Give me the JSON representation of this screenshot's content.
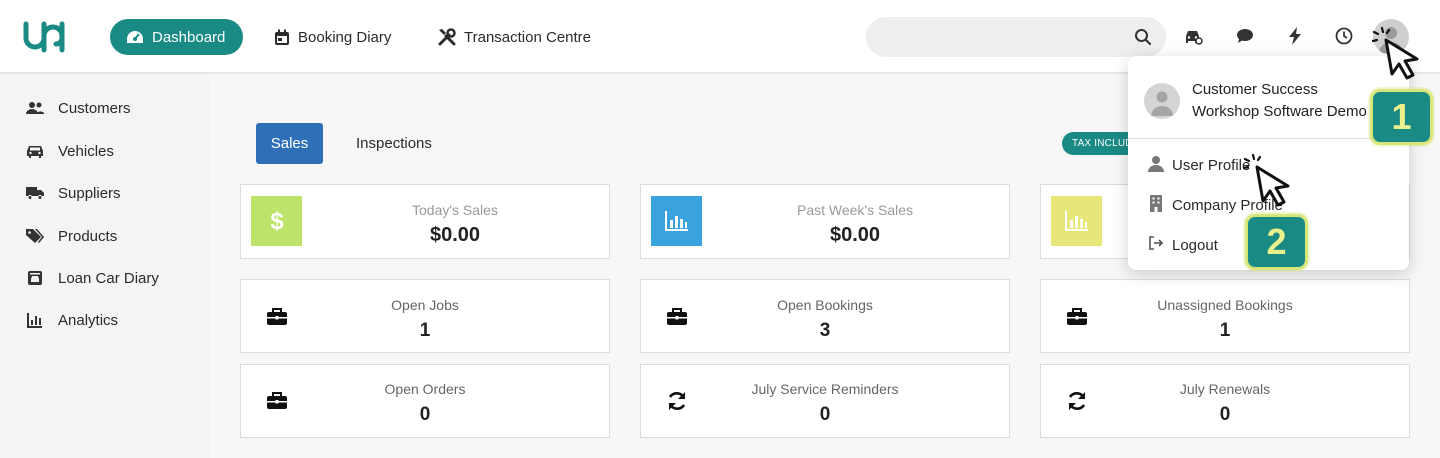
{
  "nav": {
    "dashboard": "Dashboard",
    "booking_diary": "Booking Diary",
    "transaction_centre": "Transaction Centre"
  },
  "search": {
    "placeholder": ""
  },
  "sidebar": {
    "items": [
      {
        "label": "Customers",
        "icon": "users-icon"
      },
      {
        "label": "Vehicles",
        "icon": "car-icon"
      },
      {
        "label": "Suppliers",
        "icon": "truck-icon"
      },
      {
        "label": "Products",
        "icon": "tags-icon"
      },
      {
        "label": "Loan Car Diary",
        "icon": "loan-car-icon"
      },
      {
        "label": "Analytics",
        "icon": "chart-icon"
      }
    ]
  },
  "tabs": {
    "sales": "Sales",
    "inspections": "Inspections"
  },
  "tax_label": "TAX INCLUD",
  "summary": [
    {
      "title": "Today's Sales",
      "value": "$0.00",
      "color": "#bde36a",
      "icon": "dollar-icon"
    },
    {
      "title": "Past Week's Sales",
      "value": "$0.00",
      "color": "#3aa3df",
      "icon": "bar-chart-icon"
    },
    {
      "title": "",
      "value": "",
      "color": "#e7e779",
      "icon": "bar-chart-icon"
    }
  ],
  "stats": [
    {
      "title": "Open Jobs",
      "value": "1",
      "icon": "briefcase-icon"
    },
    {
      "title": "Open Bookings",
      "value": "3",
      "icon": "briefcase-icon"
    },
    {
      "title": "Unassigned Bookings",
      "value": "1",
      "icon": "briefcase-icon"
    },
    {
      "title": "Open Orders",
      "value": "0",
      "icon": "briefcase-icon"
    },
    {
      "title": "July Service Reminders",
      "value": "0",
      "icon": "sync-icon"
    },
    {
      "title": "July Renewals",
      "value": "0",
      "icon": "sync-icon"
    }
  ],
  "user_menu": {
    "name": "Customer Success",
    "org": "Workshop Software Demo",
    "items": [
      "User Profile",
      "Company Profile",
      "Logout"
    ]
  },
  "steps": [
    "1",
    "2"
  ],
  "colors": {
    "brand": "#1a8a84",
    "tab_active": "#2f6fb8",
    "badge_border": "#d7e57a"
  }
}
